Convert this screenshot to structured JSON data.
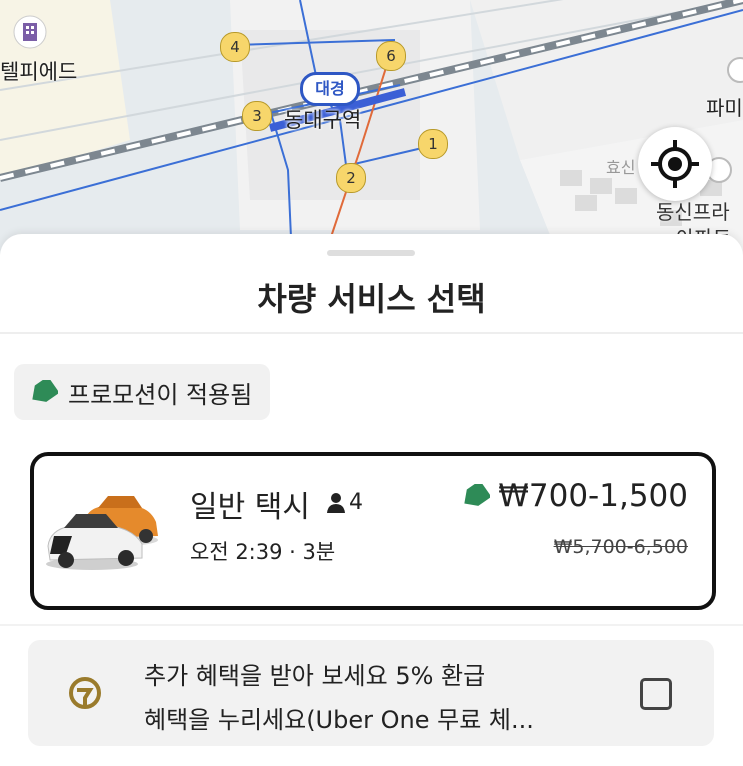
{
  "map": {
    "station_badge": "대경",
    "station_name": "동대구역",
    "place_left": "텔피에드",
    "place_right_1": "파미",
    "place_right_2": "효신",
    "place_right_3": "동신프라",
    "place_right_4": "아파트",
    "markers": [
      "4",
      "6",
      "3",
      "1",
      "2"
    ]
  },
  "sheet": {
    "title": "차량 서비스 선택",
    "promo_label": "프로모션이 적용됨"
  },
  "service": {
    "name": "일반 택시",
    "seats": "4",
    "eta": "오전 2:39 · 3분",
    "price": "₩700-1,500",
    "original_price": "₩5,700-6,500"
  },
  "uber_one": {
    "line1": "추가 혜택을 받아 보세요 5% 환급",
    "line2": "혜택을 누리세요(Uber One 무료 체...",
    "checked": false
  },
  "colors": {
    "promo_tag": "#2e8b57",
    "marker_fill": "#f7d66b",
    "transit_line": "#3b6fd6",
    "rail_line": "#e06a3a",
    "uber_one_icon": "#9a7b2c"
  },
  "icons": {
    "locate": "crosshair-icon",
    "tag": "tag-icon",
    "person": "person-icon",
    "uber_one": "uber-one-icon",
    "building": "building-icon"
  }
}
